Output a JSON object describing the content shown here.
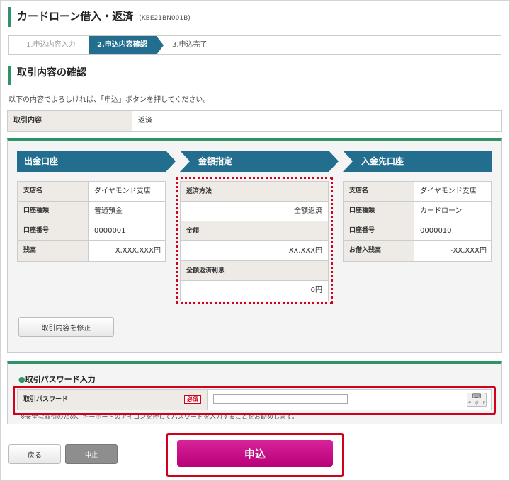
{
  "header": {
    "title": "カードローン借入・返済",
    "code": "(KBE21BN001B)"
  },
  "steps": [
    "1.申込内容入力",
    "2.申込内容確認",
    "3.申込完了"
  ],
  "section": {
    "title": "取引内容の確認",
    "instruction": "以下の内容でよろしければ、「申込」ボタンを押してください。"
  },
  "summary": {
    "label": "取引内容",
    "value": "返済"
  },
  "withdraw": {
    "heading": "出金口座",
    "rows": [
      {
        "label": "支店名",
        "value": "ダイヤモンド支店"
      },
      {
        "label": "口座種類",
        "value": "普通預金"
      },
      {
        "label": "口座番号",
        "value": "0000001"
      },
      {
        "label": "残高",
        "value": "X,XXX,XXX円"
      }
    ]
  },
  "amount": {
    "heading": "金額指定",
    "rows": [
      {
        "label": "返済方法",
        "value": "全額返済"
      },
      {
        "label": "金額",
        "value": "XX,XXX円"
      },
      {
        "label": "全額返済利息",
        "value": "0円"
      }
    ]
  },
  "deposit": {
    "heading": "入金先口座",
    "rows": [
      {
        "label": "支店名",
        "value": "ダイヤモンド支店"
      },
      {
        "label": "口座種類",
        "value": "カードローン"
      },
      {
        "label": "口座番号",
        "value": "0000010"
      },
      {
        "label": "お借入残高",
        "value": "-XX,XXX円"
      }
    ]
  },
  "modify_button": "取引内容を修正",
  "password": {
    "title": "取引パスワード入力",
    "label": "取引パスワード",
    "required": "必須",
    "keyboard_label": "キーボード",
    "note": "※安全な取引のため、キーボードのアイコンを押してパスワードを入力することをお勧めします。"
  },
  "buttons": {
    "back": "戻る",
    "cancel": "中止",
    "submit": "申込"
  },
  "colors": {
    "accent": "#2e9467",
    "header_blue": "#236e8e",
    "submit": "#c80d87",
    "highlight": "#d0021b"
  }
}
